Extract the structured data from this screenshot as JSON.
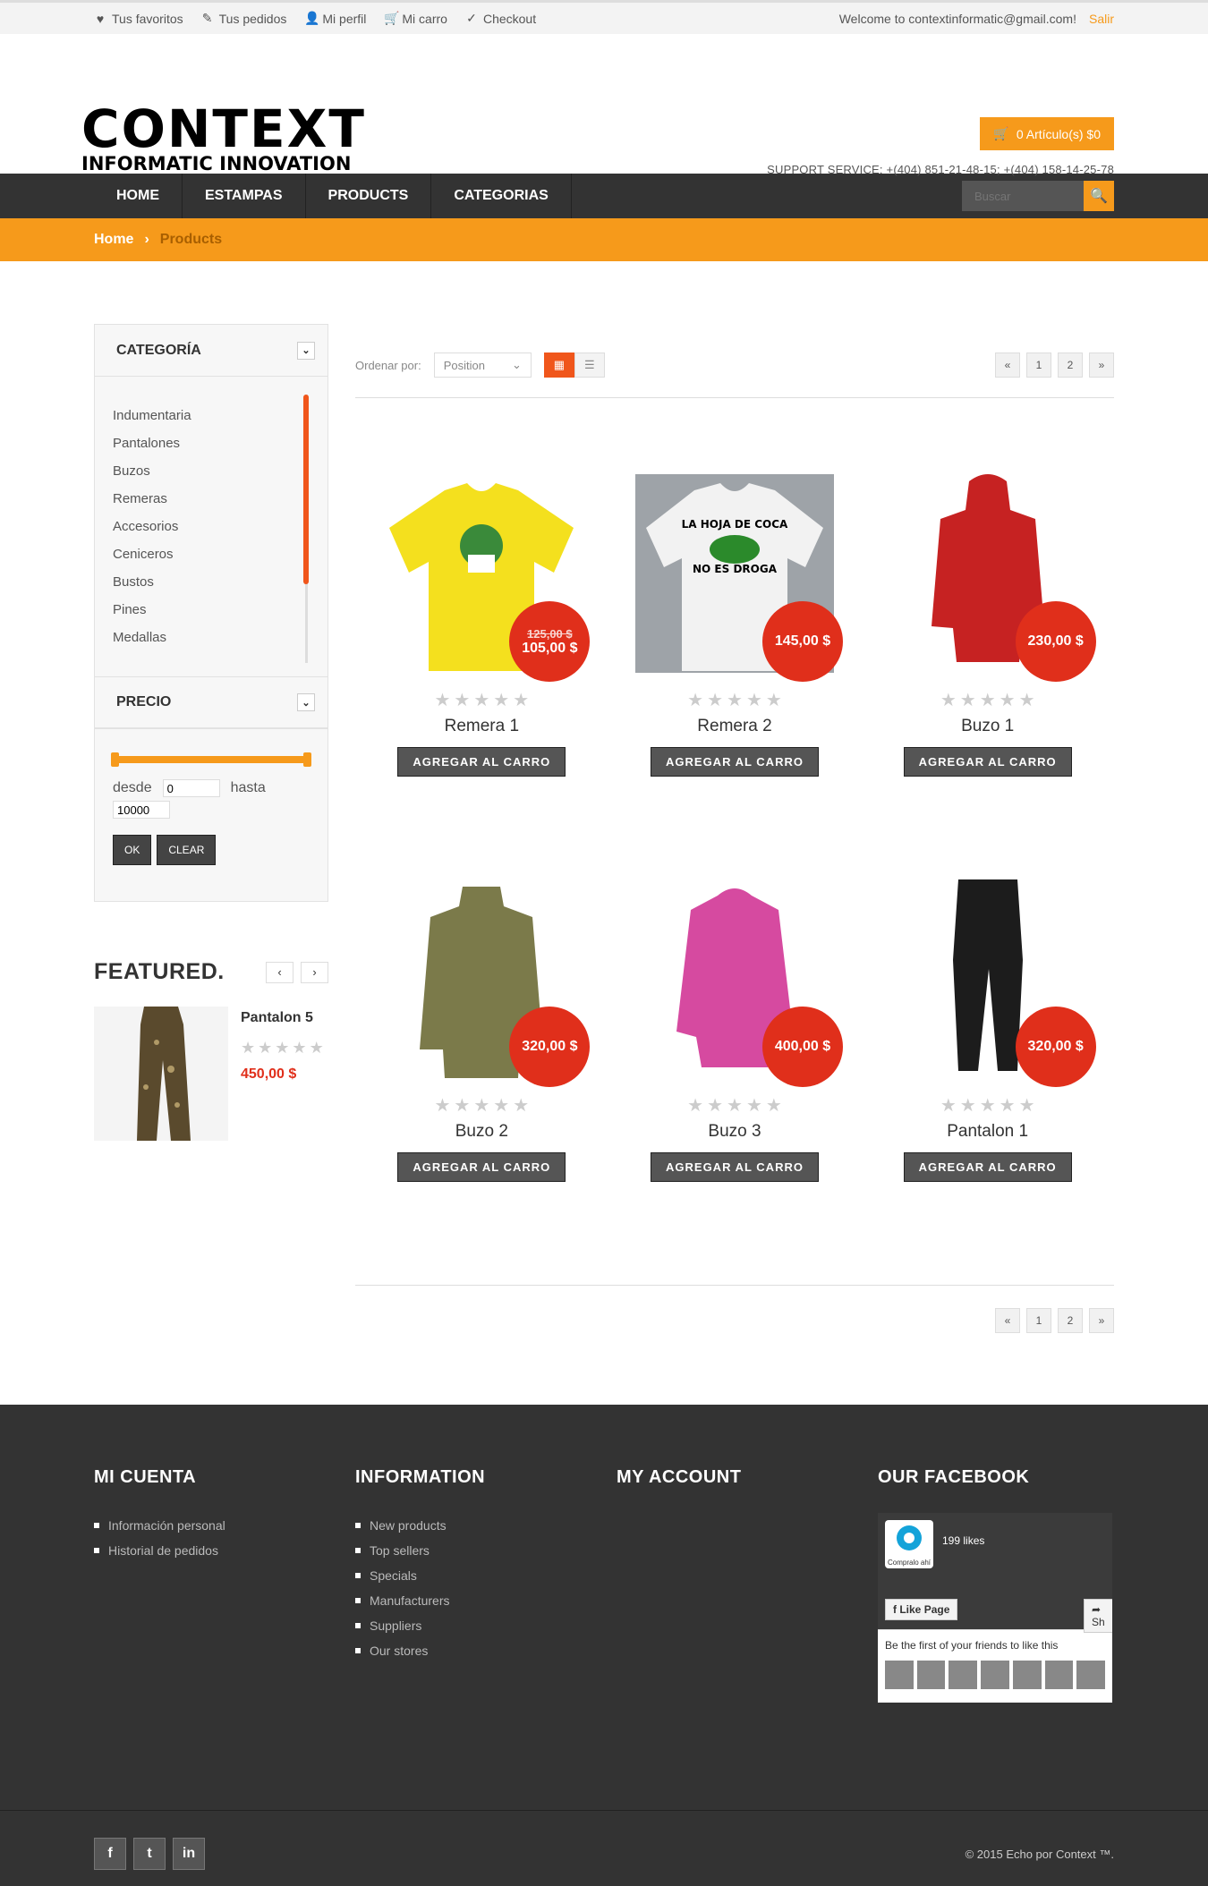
{
  "topbar": {
    "links": [
      {
        "icon": "heart-icon",
        "glyph": "♥",
        "label": "Tus favoritos"
      },
      {
        "icon": "edit-icon",
        "glyph": "✎",
        "label": "Tus pedidos"
      },
      {
        "icon": "user-icon",
        "glyph": "👤",
        "label": "Mi perfil"
      },
      {
        "icon": "cart-icon",
        "glyph": "🛒",
        "label": "Mi carro"
      },
      {
        "icon": "check-icon",
        "glyph": "✓",
        "label": "Checkout"
      }
    ],
    "welcome": "Welcome to contextinformatic@gmail.com!",
    "logout": "Salir"
  },
  "header": {
    "logo_main": "CONTEXT",
    "logo_sub": "INFORMATIC INNOVATION",
    "cart_label": "0 Artículo(s) $0",
    "support": "SUPPORT SERVICE: +(404) 851-21-48-15; +(404) 158-14-25-78"
  },
  "nav": {
    "items": [
      "HOME",
      "ESTAMPAS",
      "PRODUCTS",
      "CATEGORIAS"
    ],
    "search_placeholder": "Buscar"
  },
  "breadcrumb": {
    "home": "Home",
    "separator": "›",
    "current": "Products"
  },
  "sidebar": {
    "category_title": "CATEGORÍA",
    "categories": [
      "Indumentaria",
      "Pantalones",
      "Buzos",
      "Remeras",
      "Accesorios",
      "Ceniceros",
      "Bustos",
      "Pines",
      "Medallas"
    ],
    "price_title": "PRECIO",
    "from_label": "desde",
    "to_label": "hasta",
    "from_value": "0",
    "to_value": "10000",
    "ok": "OK",
    "clear": "CLEAR",
    "featured_title": "FEATURED.",
    "featured_product": {
      "name": "Pantalon 5",
      "price": "450,00 $",
      "rating": 0
    }
  },
  "toolbar": {
    "sort_label": "Ordenar por:",
    "sort_value": "Position",
    "pages": [
      "«",
      "1",
      "2",
      "»"
    ]
  },
  "products": [
    {
      "name": "Remera 1",
      "price": "105,00 $",
      "old_price": "125,00 $",
      "image": "yellow-tshirt",
      "color": "#f4e01e",
      "rating": 0
    },
    {
      "name": "Remera 2",
      "price": "145,00 $",
      "image": "white-tshirt",
      "color": "#f2f2f2",
      "rating": 0
    },
    {
      "name": "Buzo 1",
      "price": "230,00 $",
      "image": "red-hoodie",
      "color": "#c62222",
      "rating": 0
    },
    {
      "name": "Buzo 2",
      "price": "320,00 $",
      "image": "olive-sweater",
      "color": "#7b7a4a",
      "rating": 0
    },
    {
      "name": "Buzo 3",
      "price": "400,00 $",
      "image": "pink-hoodie",
      "color": "#d64aa0",
      "rating": 0
    },
    {
      "name": "Pantalon 1",
      "price": "320,00 $",
      "image": "black-pants",
      "color": "#1c1c1c",
      "rating": 0
    }
  ],
  "add_to_cart": "AGREGAR AL CARRO",
  "footer": {
    "columns": [
      {
        "title": "MI CUENTA",
        "links": [
          "Información personal",
          "Historial de pedidos"
        ]
      },
      {
        "title": "INFORMATION",
        "links": [
          "New products",
          "Top sellers",
          "Specials",
          "Manufacturers",
          "Suppliers",
          "Our stores"
        ]
      },
      {
        "title": "MY ACCOUNT",
        "links": []
      },
      {
        "title": "OUR FACEBOOK",
        "links": []
      }
    ],
    "facebook": {
      "likes": "199 likes",
      "logo_text": "Compralo ahí",
      "like_button": "Like Page",
      "share": "Sh",
      "friends_text": "Be the first of your friends to like this"
    },
    "copyright": "© 2015 Echo por Context ™.",
    "social": [
      "f",
      "t",
      "in"
    ]
  },
  "colors": {
    "accent": "#f69a1b",
    "badge": "#e02f1b",
    "dark": "#333333"
  }
}
